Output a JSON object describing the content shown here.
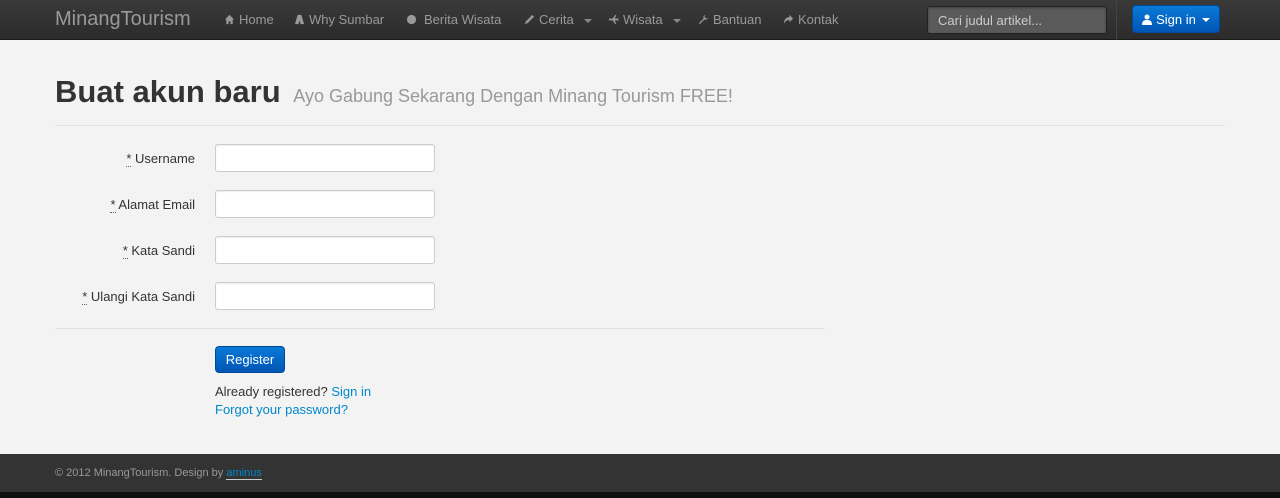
{
  "navbar": {
    "brand": "MinangTourism",
    "items": [
      {
        "label": "Home",
        "icon": "home-icon"
      },
      {
        "label": "Why Sumbar",
        "icon": "road-icon"
      },
      {
        "label": "Berita Wisata",
        "icon": "globe-icon"
      },
      {
        "label": "Cerita",
        "icon": "pencil-icon",
        "dropdown": true
      },
      {
        "label": "Wisata",
        "icon": "plane-icon",
        "dropdown": true
      },
      {
        "label": "Bantuan",
        "icon": "wrench-icon"
      },
      {
        "label": "Kontak",
        "icon": "share-icon"
      }
    ],
    "search_placeholder": "Cari judul artikel...",
    "signin_label": "Sign in"
  },
  "header": {
    "title": "Buat akun baru",
    "subtitle": "Ayo Gabung Sekarang Dengan Minang Tourism FREE!"
  },
  "form": {
    "required_mark": "*",
    "fields": [
      {
        "label": "Username",
        "value": ""
      },
      {
        "label": "Alamat Email",
        "value": ""
      },
      {
        "label": "Kata Sandi",
        "value": ""
      },
      {
        "label": "Ulangi Kata Sandi",
        "value": ""
      }
    ],
    "register_label": "Register",
    "already_text": "Already registered?",
    "signin_link": "Sign in",
    "forgot_link": "Forgot your password?"
  },
  "footer": {
    "text": "© 2012 MinangTourism. Design by",
    "author_link": "aminus"
  },
  "colors": {
    "navbar": "#2f2f2f",
    "primary": "#0066cc",
    "link": "#0088cc",
    "background": "#f3f3f3",
    "footer": "#333333"
  }
}
